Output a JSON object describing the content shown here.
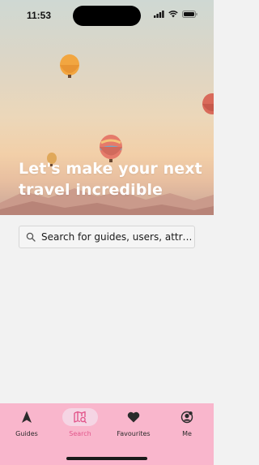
{
  "status_bar": {
    "time": "11:53",
    "icons": [
      "signal-icon",
      "wifi-icon",
      "battery-icon"
    ]
  },
  "hero": {
    "title": "Let's make your next travel incredible"
  },
  "search": {
    "placeholder": "Search for guides, users, attr…",
    "icon": "search-icon"
  },
  "tab_bar": {
    "tabs": [
      {
        "label": "Guides",
        "icon": "navigation-arrow-icon",
        "active": false
      },
      {
        "label": "Search",
        "icon": "map-search-icon",
        "active": true
      },
      {
        "label": "Favourites",
        "icon": "heart-icon",
        "active": false
      },
      {
        "label": "Me",
        "icon": "profile-icon",
        "active": false
      }
    ],
    "background_color": "#f9b6cc",
    "active_color": "#e2568b"
  }
}
